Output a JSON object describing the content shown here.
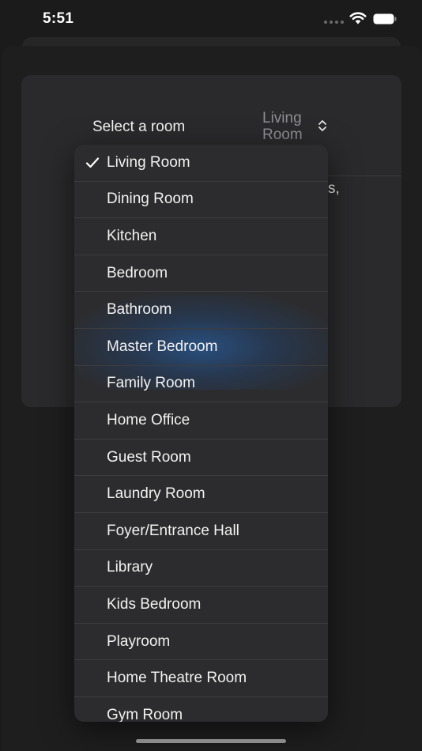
{
  "status_bar": {
    "time": "5:51"
  },
  "form": {
    "room_label": "Select a room",
    "room_value": "Living Room",
    "fragment_text": "s,"
  },
  "menu": {
    "items": [
      {
        "label": "Living Room",
        "selected": true
      },
      {
        "label": "Dining Room",
        "selected": false
      },
      {
        "label": "Kitchen",
        "selected": false
      },
      {
        "label": "Bedroom",
        "selected": false
      },
      {
        "label": "Bathroom",
        "selected": false
      },
      {
        "label": "Master Bedroom",
        "selected": false
      },
      {
        "label": "Family Room",
        "selected": false
      },
      {
        "label": "Home Office",
        "selected": false
      },
      {
        "label": "Guest Room",
        "selected": false
      },
      {
        "label": "Laundry Room",
        "selected": false
      },
      {
        "label": "Foyer/Entrance Hall",
        "selected": false
      },
      {
        "label": "Library",
        "selected": false
      },
      {
        "label": "Kids Bedroom",
        "selected": false
      },
      {
        "label": "Playroom",
        "selected": false
      },
      {
        "label": "Home Theatre Room",
        "selected": false
      },
      {
        "label": "Gym Room",
        "selected": false
      }
    ]
  },
  "icons": {
    "wifi": "wifi-icon",
    "battery": "battery-icon",
    "chevron": "chevron-updown-icon",
    "check": "checkmark-icon"
  },
  "colors": {
    "background": "#1b1b1b",
    "card": "#2a2a2c",
    "menu": "#2c2c2e",
    "highlight": "#28558c",
    "secondary_text": "#8e8e93"
  }
}
